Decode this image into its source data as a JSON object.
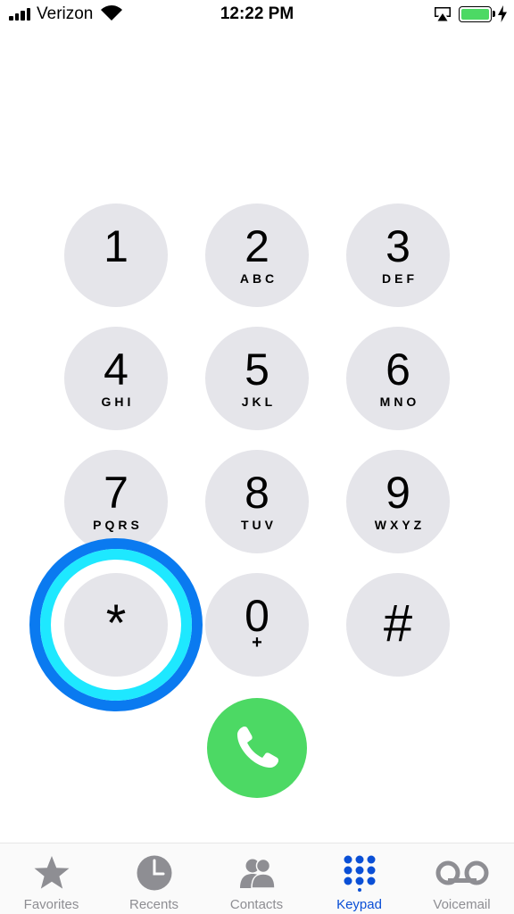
{
  "status_bar": {
    "carrier": "Verizon",
    "time": "12:22 PM",
    "battery_level": 1.0,
    "charging": true,
    "battery_color": "#4cd964"
  },
  "keypad": {
    "keys": [
      {
        "digit": "1",
        "letters": ""
      },
      {
        "digit": "2",
        "letters": "ABC"
      },
      {
        "digit": "3",
        "letters": "DEF"
      },
      {
        "digit": "4",
        "letters": "GHI"
      },
      {
        "digit": "5",
        "letters": "JKL"
      },
      {
        "digit": "6",
        "letters": "MNO"
      },
      {
        "digit": "7",
        "letters": "PQRS"
      },
      {
        "digit": "8",
        "letters": "TUV"
      },
      {
        "digit": "9",
        "letters": "WXYZ"
      },
      {
        "digit": "*",
        "letters": ""
      },
      {
        "digit": "0",
        "letters": "+"
      },
      {
        "digit": "#",
        "letters": ""
      }
    ],
    "key_color": "#e5e5ea",
    "call_button_color": "#4cd964",
    "pressed_key": "*"
  },
  "tab_bar": {
    "tabs": [
      {
        "label": "Favorites",
        "icon": "star-icon"
      },
      {
        "label": "Recents",
        "icon": "clock-icon"
      },
      {
        "label": "Contacts",
        "icon": "contacts-icon"
      },
      {
        "label": "Keypad",
        "icon": "keypad-icon"
      },
      {
        "label": "Voicemail",
        "icon": "voicemail-icon"
      }
    ],
    "active_tab": "Keypad",
    "active_color": "#0a4fd6",
    "inactive_color": "#8e8e93"
  }
}
